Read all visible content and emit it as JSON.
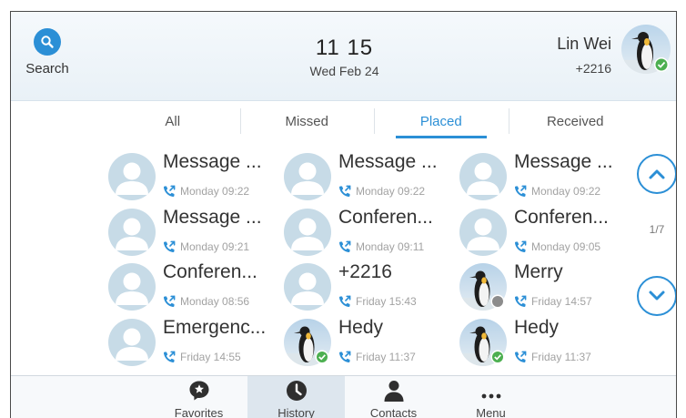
{
  "header": {
    "search_label": "Search",
    "time": "11 15",
    "date": "Wed Feb 24",
    "account_name": "Lin Wei",
    "account_number": "+2216"
  },
  "tabs": [
    {
      "label": "All"
    },
    {
      "label": "Missed"
    },
    {
      "label": "Placed",
      "active": true
    },
    {
      "label": "Received"
    }
  ],
  "history": [
    {
      "name": "Message ...",
      "time": "Monday 09:22",
      "avatar": "default-avatar"
    },
    {
      "name": "Message ...",
      "time": "Monday 09:22",
      "avatar": "default-avatar"
    },
    {
      "name": "Message ...",
      "time": "Monday 09:22",
      "avatar": "default-avatar"
    },
    {
      "name": "Message ...",
      "time": "Monday 09:21",
      "avatar": "default-avatar"
    },
    {
      "name": "Conferen...",
      "time": "Monday 09:11",
      "avatar": "default-avatar"
    },
    {
      "name": "Conferen...",
      "time": "Monday 09:05",
      "avatar": "default-avatar"
    },
    {
      "name": "Conferen...",
      "time": "Monday 08:56",
      "avatar": "default-avatar"
    },
    {
      "name": "+2216",
      "time": "Friday 15:43",
      "avatar": "default-avatar"
    },
    {
      "name": "Merry",
      "time": "Friday 14:57",
      "avatar": "penguin-avatar",
      "status": "offline"
    },
    {
      "name": "Emergenc...",
      "time": "Friday 14:55",
      "avatar": "default-avatar"
    },
    {
      "name": "Hedy",
      "time": "Friday 11:37",
      "avatar": "penguin-avatar",
      "status": "online"
    },
    {
      "name": "Hedy",
      "time": "Friday 11:37",
      "avatar": "penguin-avatar",
      "status": "online"
    }
  ],
  "pager": {
    "indicator": "1/7"
  },
  "bottom_nav": [
    {
      "label": "Favorites",
      "icon": "star-bubble-icon"
    },
    {
      "label": "History",
      "icon": "clock-icon",
      "active": true
    },
    {
      "label": "Contacts",
      "icon": "person-icon"
    },
    {
      "label": "Menu",
      "icon": "more-dots-icon"
    }
  ],
  "colors": {
    "accent": "#2b8fd6",
    "avatar_default": "#c7dbe7",
    "online": "#4caf50",
    "offline": "#8c8c8c"
  }
}
